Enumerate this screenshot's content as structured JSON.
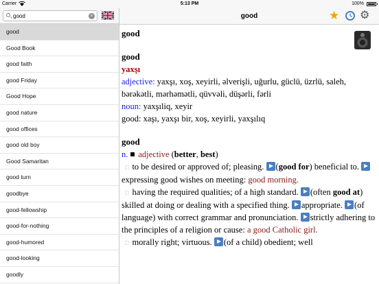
{
  "status_bar": {
    "carrier": "Carrier",
    "time": "5:13 PM",
    "battery": "100%"
  },
  "search": {
    "value": "good",
    "clear_icon": "×",
    "flag": "uk-flag-icon"
  },
  "word_list": [
    "good",
    "Good Book",
    "good faith",
    "good Friday",
    "Good Hope",
    "good nature",
    "good offices",
    "good old boy",
    "Good Samaritan",
    "good turn",
    "goodbye",
    "good-fellowship",
    "good-for-nothing",
    "good-humored",
    "good-looking",
    "goodly"
  ],
  "navbar": {
    "title": "good",
    "star": "★",
    "gear": "⚙"
  },
  "entry1": {
    "headword": "good",
    "headword2": "good",
    "translation_word": "yaxşı",
    "adj_label": "adjective:",
    "adj_text": "yaxşı, xoş, xeyirli, əlverişli, uğurlu, güclü, üzrlü, saleh, bərəkətli, mərhəmətli, qüvvəli, düşərli, fərli",
    "noun_label": "noun:",
    "noun_text": "yaxşıliq, xeyir",
    "good_label": "good:",
    "good_text": "xaşı, yaxşı bir, xoş, xeyirli, yaxşılıq"
  },
  "entry2": {
    "headword": "good",
    "pos_abbr": "n.",
    "pos_full": "adjective",
    "forms_open": "(",
    "form1": "better",
    "forms_sep": ", ",
    "form2": "best",
    "forms_close": ")",
    "bullet": "□",
    "s1_text": "to be desired or approved of; pleasing.",
    "s1_bold_open": "(",
    "s1_bold": "good for",
    "s1_bold_close": ")",
    "s1_rest": "beneficial to.",
    "s1_text2": "expressing good wishes on meeting:",
    "s1_example": "good morning.",
    "s2_text": "having the required qualities; of a high standard.",
    "s2_open": "(often ",
    "s2_bold": "good at",
    "s2_close": ")",
    "s2_rest": "skilled at doing or dealing with a specified thing.",
    "s2_text2": "appropriate.",
    "s2_text3": "(of language) with correct grammar and pronunciation.",
    "s2_text4": "strictly adhering to the principles of a religion or cause:",
    "s2_example": "a good Catholic girl.",
    "s3_text": "morally right; virtuous.",
    "s3_text2": "(of a child) obedient; well"
  }
}
